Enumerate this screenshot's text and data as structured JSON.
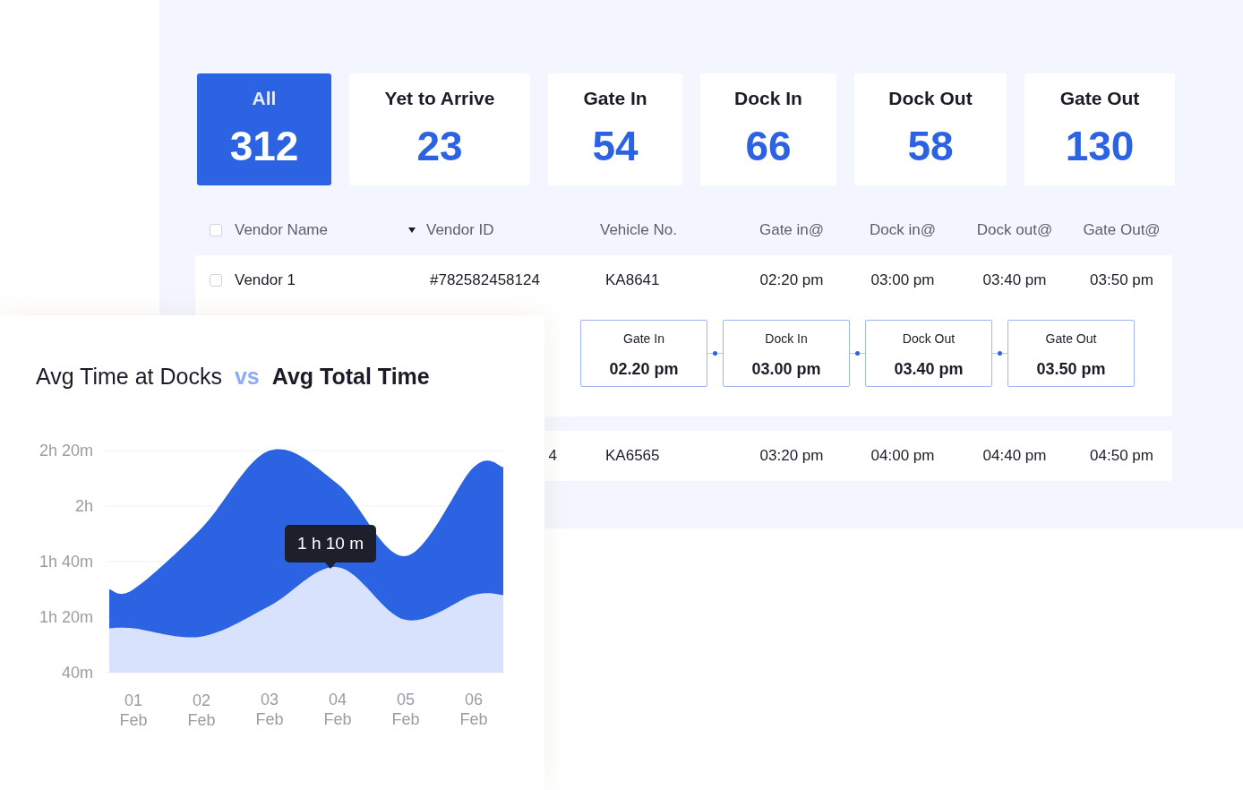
{
  "status_cards": [
    {
      "label": "All",
      "count": "312",
      "selected": true
    },
    {
      "label": "Yet to Arrive",
      "count": "23",
      "selected": false
    },
    {
      "label": "Gate In",
      "count": "54",
      "selected": false
    },
    {
      "label": "Dock In",
      "count": "66",
      "selected": false
    },
    {
      "label": "Dock Out",
      "count": "58",
      "selected": false
    },
    {
      "label": "Gate Out",
      "count": "130",
      "selected": false
    }
  ],
  "table": {
    "select_all_checked": false,
    "columns": [
      "Vendor Name",
      "Vendor ID",
      "Vehicle No.",
      "Gate in@",
      "Dock in@",
      "Dock out@",
      "Gate Out@"
    ],
    "rows": [
      {
        "checked": false,
        "expanded": true,
        "vendor_name": "Vendor 1",
        "vendor_id": "#782582458124",
        "vehicle_no": "KA8641",
        "gate_in": "02:20 pm",
        "dock_in": "03:00 pm",
        "dock_out": "03:40 pm",
        "gate_out": "03:50 pm",
        "timeline": [
          {
            "label": "Gate In",
            "time": "02.20 pm"
          },
          {
            "label": "Dock In",
            "time": "03.00 pm"
          },
          {
            "label": "Dock Out",
            "time": "03.40 pm"
          },
          {
            "label": "Gate Out",
            "time": "03.50 pm"
          }
        ]
      },
      {
        "vendor_id": "4",
        "vehicle_no": "KA6565",
        "gate_in": "03:20 pm",
        "dock_in": "04:00 pm",
        "dock_out": "04:40 pm",
        "gate_out": "04:50 pm"
      }
    ]
  },
  "chart_card": {
    "title_left": "Avg Time at Docks",
    "title_vs": "vs",
    "title_right": "Avg Total Time",
    "tooltip": "1 h 10 m",
    "y_axis_labels": [
      "2h 20m",
      "2h",
      "1h 40m",
      "1h 20m",
      "40m"
    ],
    "x_axis_labels": [
      "01 Feb",
      "02 Feb",
      "03 Feb",
      "04 Feb",
      "05 Feb",
      "06 Feb"
    ]
  }
}
